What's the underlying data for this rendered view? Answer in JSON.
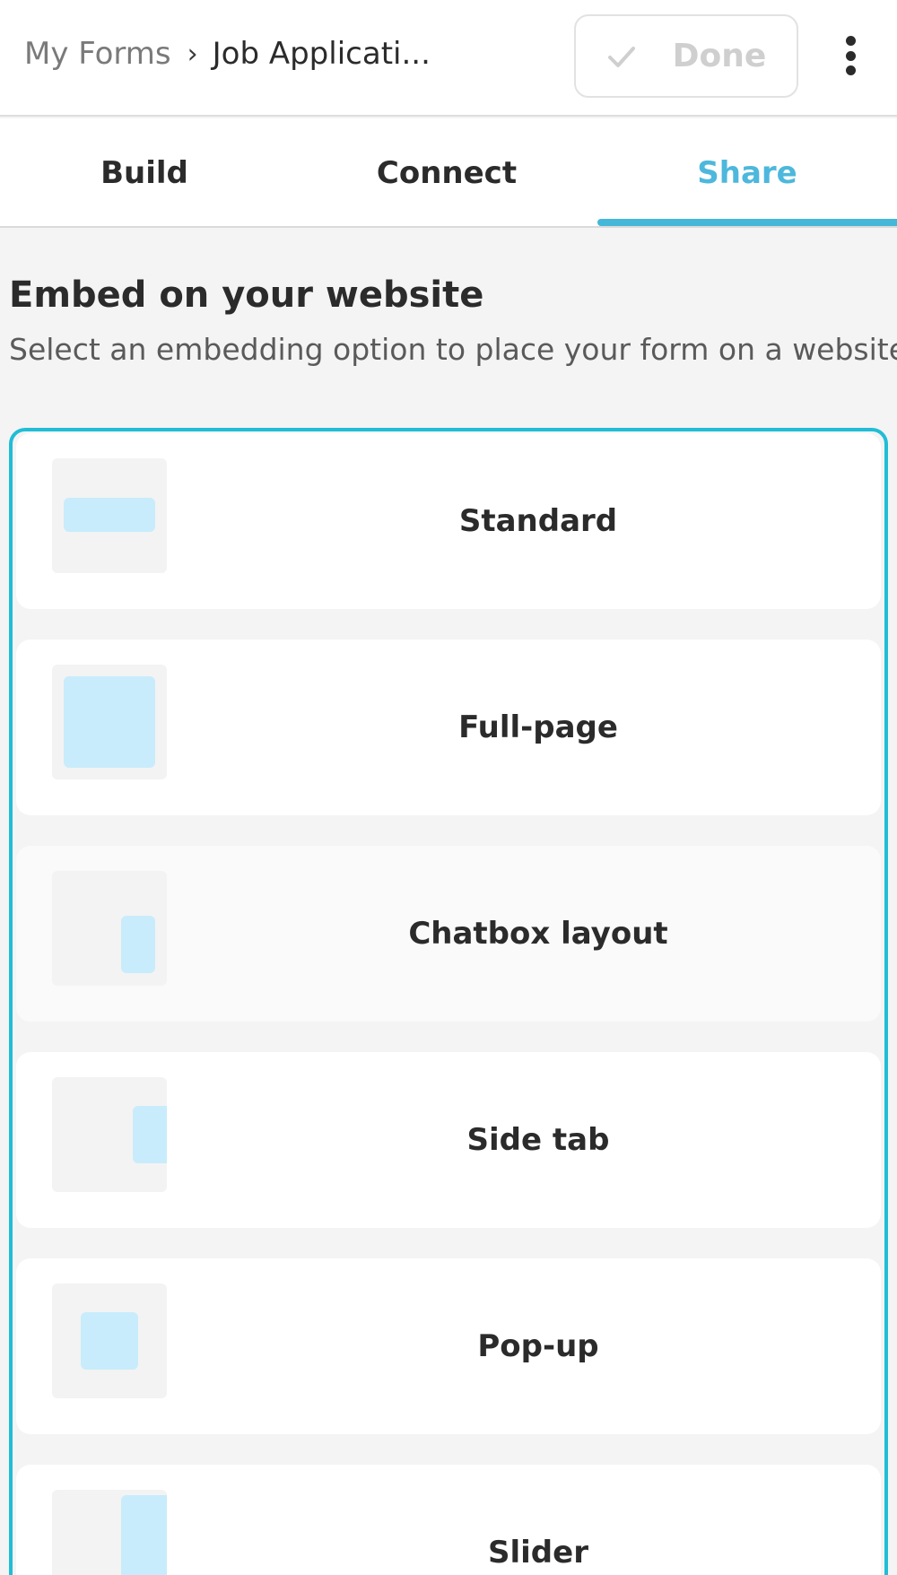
{
  "header": {
    "breadcrumb_root": "My Forms",
    "breadcrumb_separator": "›",
    "breadcrumb_current": "Job Applicati...",
    "done_label": "Done"
  },
  "tabs": [
    {
      "label": "Build",
      "active": false
    },
    {
      "label": "Connect",
      "active": false
    },
    {
      "label": "Share",
      "active": true
    }
  ],
  "section": {
    "title": "Embed on your website",
    "description": "Select an embedding option to place your form on a website."
  },
  "embed_options": [
    {
      "label": "Standard",
      "icon": "standard-layout-icon"
    },
    {
      "label": "Full-page",
      "icon": "full-page-layout-icon"
    },
    {
      "label": "Chatbox layout",
      "icon": "chatbox-layout-icon"
    },
    {
      "label": "Side tab",
      "icon": "side-tab-layout-icon"
    },
    {
      "label": "Pop-up",
      "icon": "pop-up-layout-icon"
    },
    {
      "label": "Slider",
      "icon": "slider-layout-icon"
    }
  ],
  "colors": {
    "accent": "#45b7d8",
    "panel_border": "#21bdd6",
    "thumb_fill": "#c8ecfb",
    "done_disabled": "#cfcfcf"
  }
}
